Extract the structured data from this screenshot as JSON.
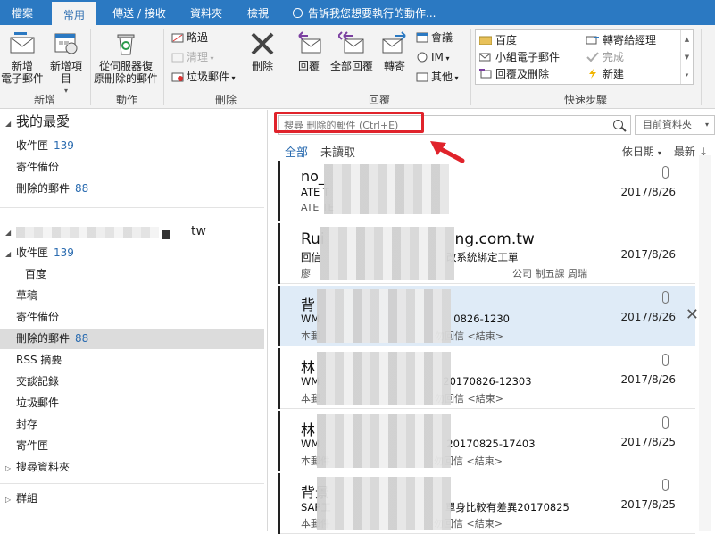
{
  "tabs": [
    {
      "label": "檔案"
    },
    {
      "label": "常用"
    },
    {
      "label": "傳送 / 接收"
    },
    {
      "label": "資料夾"
    },
    {
      "label": "檢視"
    }
  ],
  "tellme": "告訴我您想要執行的動作...",
  "ribbon": {
    "new_email": "新增\n電子郵件",
    "new_items": "新增項目",
    "restore": "從伺服器復\n原刪除的郵件",
    "ignore": "略過",
    "cleanup": "清理",
    "junk": "垃圾郵件",
    "delete": "刪除",
    "reply": "回覆",
    "reply_all": "全部回覆",
    "forward": "轉寄",
    "meeting": "會議",
    "im": "IM",
    "more": "其他",
    "groups": {
      "new": "新增",
      "actions": "動作",
      "delete": "刪除",
      "respond": "回覆",
      "quicksteps": "快速步驟"
    },
    "quicksteps": [
      {
        "label": "百度",
        "disabled": false
      },
      {
        "label": "轉寄給經理",
        "disabled": false
      },
      {
        "label": "小組電子郵件",
        "disabled": false
      },
      {
        "label": "完成",
        "disabled": true
      },
      {
        "label": "回覆及刪除",
        "disabled": false
      },
      {
        "label": "新建",
        "disabled": false
      }
    ]
  },
  "favorites": {
    "title": "我的最愛",
    "items": [
      {
        "label": "收件匣",
        "count": "139"
      },
      {
        "label": "寄件備份",
        "count": ""
      },
      {
        "label": "刪除的郵件",
        "count": "88"
      }
    ]
  },
  "account": {
    "suffix": "tw",
    "items": [
      {
        "label": "收件匣",
        "count": "139",
        "indent": 0,
        "tri": "◢"
      },
      {
        "label": "百度",
        "count": "",
        "indent": 1,
        "tri": ""
      },
      {
        "label": "草稿",
        "count": "",
        "indent": 0,
        "tri": ""
      },
      {
        "label": "寄件備份",
        "count": "",
        "indent": 0,
        "tri": ""
      },
      {
        "label": "刪除的郵件",
        "count": "88",
        "indent": 0,
        "tri": "",
        "selected": true
      },
      {
        "label": "RSS 摘要",
        "count": "",
        "indent": 0,
        "tri": ""
      },
      {
        "label": "交談記錄",
        "count": "",
        "indent": 0,
        "tri": ""
      },
      {
        "label": "垃圾郵件",
        "count": "",
        "indent": 0,
        "tri": ""
      },
      {
        "label": "封存",
        "count": "",
        "indent": 0,
        "tri": ""
      },
      {
        "label": "寄件匣",
        "count": "",
        "indent": 0,
        "tri": ""
      },
      {
        "label": "搜尋資料夾",
        "count": "",
        "indent": 0,
        "tri": "▷"
      }
    ]
  },
  "groups_label": "群組",
  "search": {
    "placeholder": "搜尋 刪除的郵件 (Ctrl+E)",
    "scope": "目前資料夾"
  },
  "filters": {
    "all": "全部",
    "unread": "未讀取"
  },
  "sort": {
    "by": "依日期",
    "order": "最新"
  },
  "mails": [
    {
      "from": "no_",
      "subject": "ATE T",
      "preview": "ATE TE",
      "date": "2017/8/26",
      "attach": true
    },
    {
      "from": "Rui",
      "from_tail": "ng.com.tw",
      "subject": "回信",
      "subject_tail": "改系統綁定工單",
      "preview": "廖",
      "preview_tail": "公司 制五課 周瑞",
      "date": "2017/8/26",
      "attach": false
    },
    {
      "from": "背",
      "subject": "WM",
      "subject_tail": "0826-1230",
      "preview": "本郵",
      "preview_tail": "勿回信 <結束>",
      "date": "2017/8/26",
      "attach": true,
      "selected": true
    },
    {
      "from": "林",
      "subject": "WM",
      "subject_tail": "20170826-12303",
      "preview": "本郵",
      "preview_tail": "勿回信 <結束>",
      "date": "2017/8/26",
      "attach": true
    },
    {
      "from": "林",
      "subject": "WM",
      "subject_tail": "20170825-17403",
      "preview": "本郵件",
      "preview_tail": "勿回信 <結束>",
      "date": "2017/8/25",
      "attach": true
    },
    {
      "from": "背景",
      "subject": "SAP工",
      "subject_tail": "單身比較有差異20170825",
      "preview": "本郵件",
      "preview_tail": "勿回信 <結束>",
      "date": "2017/8/25",
      "attach": true
    }
  ]
}
